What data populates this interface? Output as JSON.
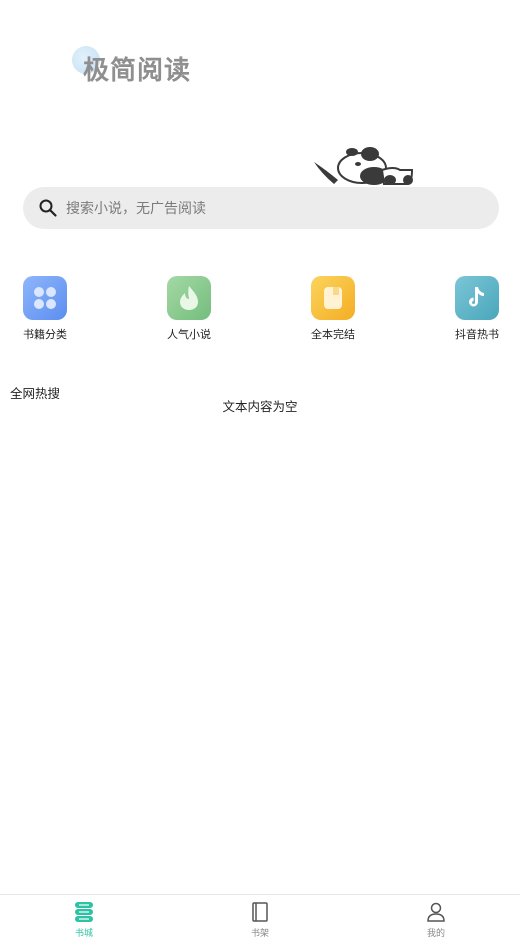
{
  "brand": {
    "logo_text": "极简阅读"
  },
  "search": {
    "placeholder": "搜索小说，无广告阅读"
  },
  "categories": [
    {
      "label": "书籍分类",
      "icon": "grid-icon",
      "color": "#6f9df5"
    },
    {
      "label": "人气小说",
      "icon": "flame-icon",
      "color": "#86c98c"
    },
    {
      "label": "全本完结",
      "icon": "book-icon",
      "color": "#f6bd35"
    },
    {
      "label": "抖音热书",
      "icon": "tiktok-icon",
      "color": "#5db5c7"
    }
  ],
  "hot_search": {
    "title": "全网热搜",
    "empty_text": "文本内容为空"
  },
  "tabbar": {
    "items": [
      {
        "label": "书城",
        "icon": "bookstore-icon",
        "active": true
      },
      {
        "label": "书架",
        "icon": "bookshelf-icon",
        "active": false
      },
      {
        "label": "我的",
        "icon": "profile-icon",
        "active": false
      }
    ],
    "active_color": "#2bc3a4",
    "inactive_color": "#888888"
  }
}
